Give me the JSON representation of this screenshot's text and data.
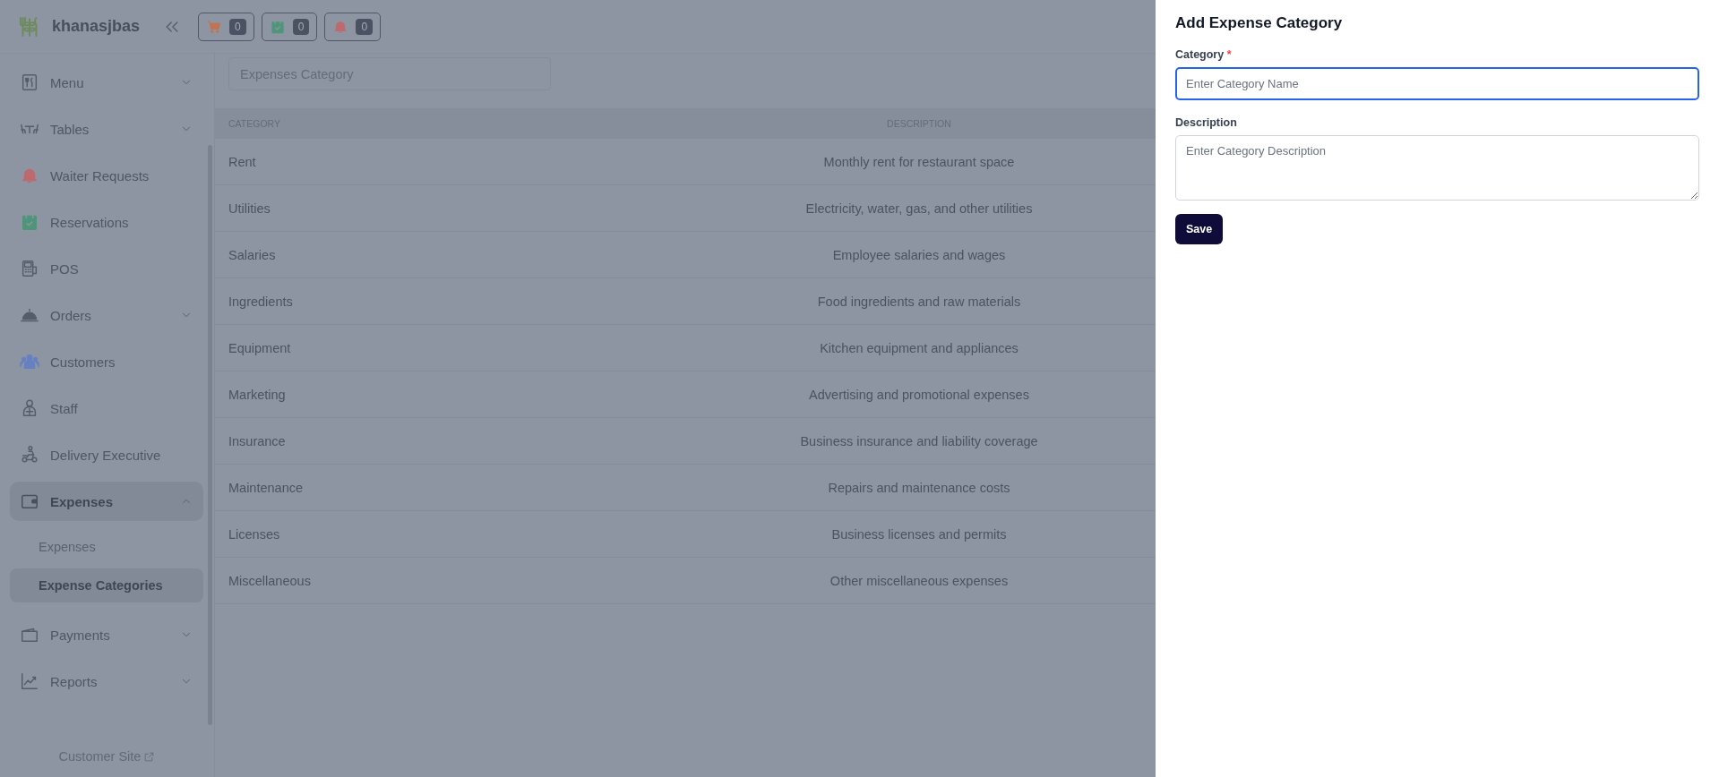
{
  "brand": {
    "name": "khanasjbas"
  },
  "header_badges": [
    {
      "count": "0"
    },
    {
      "count": "0"
    },
    {
      "count": "0"
    }
  ],
  "sidebar": {
    "items": [
      {
        "label": "Menu",
        "kind": "group",
        "selected": false,
        "expanded": false
      },
      {
        "label": "Tables",
        "kind": "group",
        "selected": false,
        "expanded": false
      },
      {
        "label": "Waiter Requests",
        "kind": "link",
        "selected": false
      },
      {
        "label": "Reservations",
        "kind": "link",
        "selected": false
      },
      {
        "label": "POS",
        "kind": "link",
        "selected": false
      },
      {
        "label": "Orders",
        "kind": "group",
        "selected": false,
        "expanded": false
      },
      {
        "label": "Customers",
        "kind": "link",
        "selected": false
      },
      {
        "label": "Staff",
        "kind": "link",
        "selected": false
      },
      {
        "label": "Delivery Executive",
        "kind": "link",
        "selected": false
      },
      {
        "label": "Expenses",
        "kind": "group",
        "selected": true,
        "expanded": true,
        "children": [
          {
            "label": "Expenses",
            "selected": false
          },
          {
            "label": "Expense Categories",
            "selected": true
          }
        ]
      },
      {
        "label": "Payments",
        "kind": "group",
        "selected": false,
        "expanded": false
      },
      {
        "label": "Reports",
        "kind": "group",
        "selected": false,
        "expanded": false
      }
    ],
    "footer_link": "Customer Site"
  },
  "search": {
    "placeholder": "Expenses Category"
  },
  "table": {
    "columns": [
      "CATEGORY",
      "DESCRIPTION"
    ],
    "rows": [
      [
        "Rent",
        "Monthly rent for restaurant space"
      ],
      [
        "Utilities",
        "Electricity, water, gas, and other utilities"
      ],
      [
        "Salaries",
        "Employee salaries and wages"
      ],
      [
        "Ingredients",
        "Food ingredients and raw materials"
      ],
      [
        "Equipment",
        "Kitchen equipment and appliances"
      ],
      [
        "Marketing",
        "Advertising and promotional expenses"
      ],
      [
        "Insurance",
        "Business insurance and liability coverage"
      ],
      [
        "Maintenance",
        "Repairs and maintenance costs"
      ],
      [
        "Licenses",
        "Business licenses and permits"
      ],
      [
        "Miscellaneous",
        "Other miscellaneous expenses"
      ]
    ]
  },
  "panel": {
    "title": "Add Expense Category",
    "fields": [
      {
        "kind": "input",
        "label": "Category",
        "required_mark": "*",
        "placeholder": "Enter Category Name",
        "focused": true
      },
      {
        "kind": "textarea",
        "label": "Description",
        "placeholder": "Enter Category Description",
        "focused": false
      }
    ],
    "button": "Save"
  }
}
